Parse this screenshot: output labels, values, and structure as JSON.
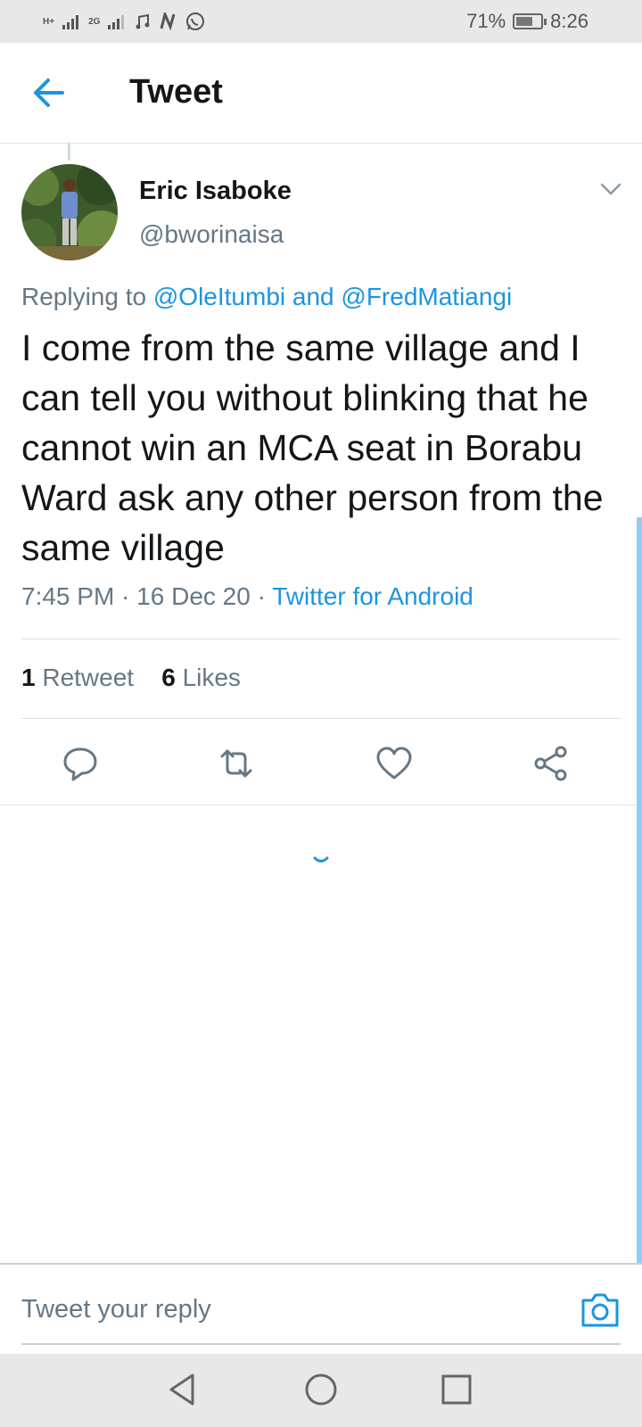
{
  "status_bar": {
    "network_1": "H+",
    "network_2": "2G",
    "battery_percent": "71%",
    "battery_level": 0.71,
    "time": "8:26"
  },
  "app_bar": {
    "title": "Tweet"
  },
  "tweet": {
    "author_name": "Eric Isaboke",
    "author_handle": "@bworinaisa",
    "replying_prefix": "Replying to ",
    "mention_1": "@OleItumbi",
    "mention_joiner": " and ",
    "mention_2": "@FredMatiangi",
    "text": "I come from the same village and I can tell you without blinking that he cannot win an MCA seat in Borabu Ward ask any other person from the same village",
    "time": "7:45 PM",
    "date": "16 Dec 20",
    "separator": " · ",
    "source": "Twitter for Android",
    "retweets_count": "1",
    "retweets_label": "Retweet",
    "likes_count": "6",
    "likes_label": "Likes"
  },
  "reply": {
    "placeholder": "Tweet your reply"
  },
  "icons": {
    "back": "back-arrow-icon",
    "chevron": "chevron-down-icon",
    "reply": "reply-icon",
    "retweet": "retweet-icon",
    "like": "heart-icon",
    "share": "share-icon",
    "camera": "camera-icon"
  },
  "colors": {
    "accent": "#1b95e0",
    "text_primary": "#14171a",
    "text_secondary": "#657786",
    "divider": "#dde3e8",
    "status_bar_bg": "#e8e8e8"
  }
}
